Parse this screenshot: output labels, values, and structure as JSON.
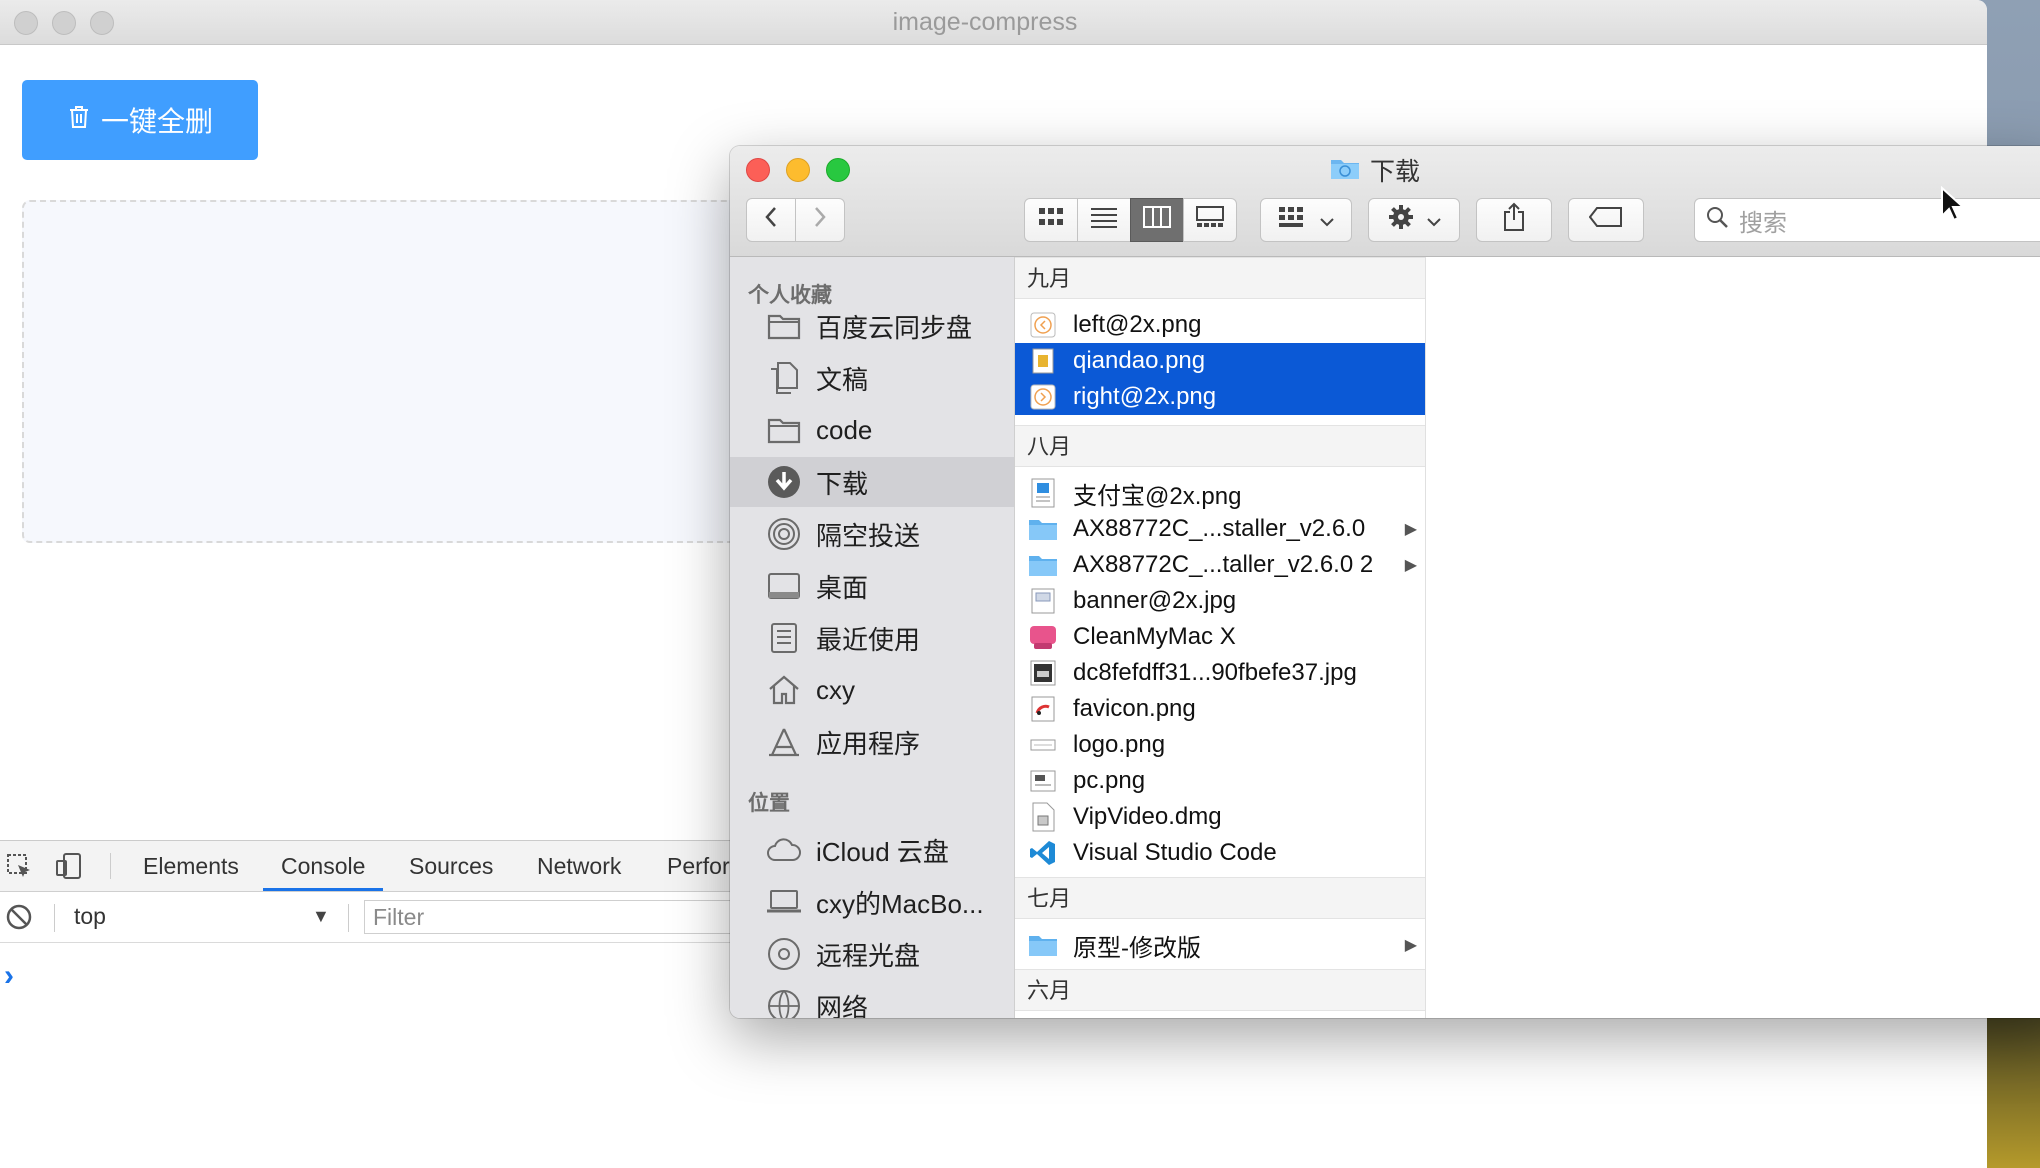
{
  "background_app": {
    "title": "image-compress",
    "delete_all_label": "一键全删"
  },
  "devtools": {
    "tabs": [
      "Elements",
      "Console",
      "Sources",
      "Network",
      "Perfor"
    ],
    "active_tab": "Console",
    "context_value": "top",
    "filter_placeholder": "Filter",
    "prompt": "›"
  },
  "finder": {
    "title": "下载",
    "search_placeholder": "搜索",
    "sidebar": {
      "favorites_heading": "个人收藏",
      "favorites": [
        {
          "label": "百度云同步盘",
          "icon": "folder-icon"
        },
        {
          "label": "文稿",
          "icon": "documents-icon"
        },
        {
          "label": "code",
          "icon": "folder-icon"
        },
        {
          "label": "下载",
          "icon": "downloads-icon",
          "selected": true
        },
        {
          "label": "隔空投送",
          "icon": "airdrop-icon"
        },
        {
          "label": "桌面",
          "icon": "desktop-icon"
        },
        {
          "label": "最近使用",
          "icon": "recents-icon"
        },
        {
          "label": "cxy",
          "icon": "home-icon"
        },
        {
          "label": "应用程序",
          "icon": "applications-icon"
        }
      ],
      "locations_heading": "位置",
      "locations": [
        {
          "label": "iCloud 云盘",
          "icon": "icloud-icon"
        },
        {
          "label": "cxy的MacBo...",
          "icon": "laptop-icon"
        },
        {
          "label": "远程光盘",
          "icon": "disc-icon"
        },
        {
          "label": "网络",
          "icon": "network-icon"
        }
      ]
    },
    "groups": [
      {
        "heading": "九月",
        "files": [
          {
            "name": "left@2x.png",
            "icon": "image-file-icon"
          },
          {
            "name": "qiandao.png",
            "icon": "image-file-icon",
            "selected": true
          },
          {
            "name": "right@2x.png",
            "icon": "image-file-icon",
            "selected": true
          }
        ]
      },
      {
        "heading": "八月",
        "files": [
          {
            "name": "支付宝@2x.png",
            "icon": "image-file-icon"
          },
          {
            "name": "AX88772C_...staller_v2.6.0",
            "icon": "folder-icon",
            "folder": true
          },
          {
            "name": "AX88772C_...taller_v2.6.0 2",
            "icon": "folder-icon",
            "folder": true
          },
          {
            "name": "banner@2x.jpg",
            "icon": "image-file-icon"
          },
          {
            "name": "CleanMyMac X",
            "icon": "app-icon"
          },
          {
            "name": "dc8fefdff31...90fbefe37.jpg",
            "icon": "image-file-icon"
          },
          {
            "name": "favicon.png",
            "icon": "image-file-icon"
          },
          {
            "name": "logo.png",
            "icon": "image-file-icon"
          },
          {
            "name": "pc.png",
            "icon": "image-file-icon"
          },
          {
            "name": "VipVideo.dmg",
            "icon": "disk-image-icon"
          },
          {
            "name": "Visual Studio Code",
            "icon": "vscode-icon"
          }
        ]
      },
      {
        "heading": "七月",
        "files": [
          {
            "name": "原型-修改版",
            "icon": "folder-icon",
            "folder": true
          }
        ]
      },
      {
        "heading": "六月",
        "files": []
      }
    ]
  },
  "colors": {
    "primary_button": "#409eff",
    "selection": "#0b59d6",
    "devtools_active": "#1a73e8"
  }
}
